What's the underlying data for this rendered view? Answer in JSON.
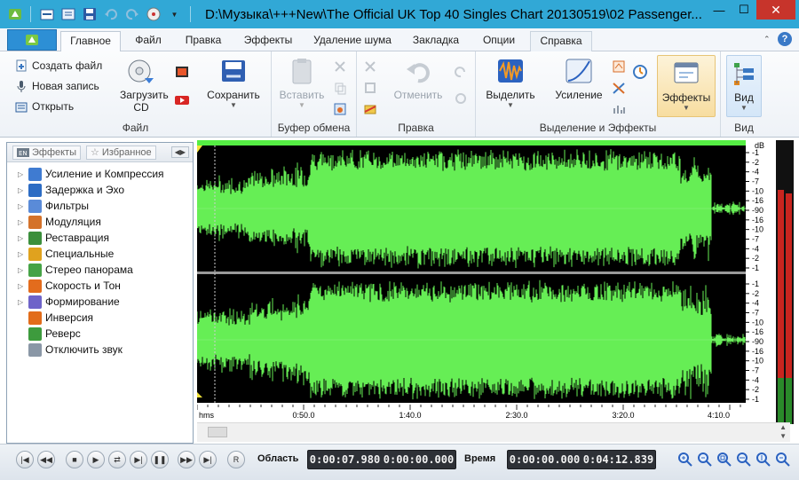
{
  "window": {
    "title": "D:\\Музыка\\+++New\\The Official UK Top 40 Singles Chart 20130519\\02 Passenger...",
    "controls": {
      "minimize": "—",
      "maximize": "☐",
      "close": "✕"
    }
  },
  "quick_access": [
    "app-icon",
    "open-icon",
    "import-icon",
    "save-icon",
    "undo-icon",
    "redo-icon",
    "cd-icon"
  ],
  "tabs": [
    {
      "label": "Главное",
      "active": true
    },
    {
      "label": "Файл"
    },
    {
      "label": "Правка"
    },
    {
      "label": "Эффекты"
    },
    {
      "label": "Удаление шума"
    },
    {
      "label": "Закладка"
    },
    {
      "label": "Опции"
    },
    {
      "label": "Справка"
    }
  ],
  "ribbon": {
    "file_group": {
      "label": "Файл",
      "create": "Создать файл",
      "record": "Новая запись",
      "open": "Открыть",
      "load_cd": "Загрузить CD",
      "save": "Сохранить"
    },
    "clipboard_group": {
      "label": "Буфер обмена",
      "paste": "Вставить"
    },
    "edit_group": {
      "label": "Правка",
      "undo": "Отменить"
    },
    "selection_group": {
      "label": "Выделение и Эффекты",
      "select": "Выделить",
      "amplify": "Усиление",
      "effects": "Эффекты"
    },
    "view_group": {
      "label": "Вид",
      "view": "Вид"
    }
  },
  "panel": {
    "tab_effects": "Эффекты",
    "tab_favorites": "Избранное",
    "items": [
      {
        "label": "Усиление и Компрессия",
        "expandable": true,
        "color": "#3f7bd1"
      },
      {
        "label": "Задержка и Эхо",
        "expandable": true,
        "color": "#2c6cc4"
      },
      {
        "label": "Фильтры",
        "expandable": true,
        "color": "#5a8bd8"
      },
      {
        "label": "Модуляция",
        "expandable": true,
        "color": "#d4722a"
      },
      {
        "label": "Реставрация",
        "expandable": true,
        "color": "#3b8f3c"
      },
      {
        "label": "Специальные",
        "expandable": true,
        "color": "#e0a21e"
      },
      {
        "label": "Стерео панорама",
        "expandable": true,
        "color": "#46a346"
      },
      {
        "label": "Скорость и Тон",
        "expandable": true,
        "color": "#e36c1d"
      },
      {
        "label": "Формирование",
        "expandable": true,
        "color": "#6e63c9"
      },
      {
        "label": "Инверсия",
        "expandable": false,
        "color": "#e26c1a"
      },
      {
        "label": "Реверс",
        "expandable": false,
        "color": "#3d9b3d"
      },
      {
        "label": "Отключить звук",
        "expandable": false,
        "color": "#8a97a6"
      }
    ]
  },
  "waveform": {
    "color": "#66ee55",
    "db_unit": "dB",
    "db_ticks": [
      "-1",
      "-2",
      "-4",
      "-7",
      "-10",
      "-16",
      "-90",
      "-16",
      "-10",
      "-7",
      "-4",
      "-2",
      "-1"
    ],
    "time_labels": [
      "hms",
      "0:50.0",
      "1:40.0",
      "2:30.0",
      "3:20.0",
      "4:10.0"
    ]
  },
  "transport": {
    "region_label": "Область",
    "region_start": "0:00:07.980",
    "region_end": "0:00:00.000",
    "time_label": "Время",
    "time_current": "0:00:00.000",
    "time_total": "0:04:12.839"
  }
}
